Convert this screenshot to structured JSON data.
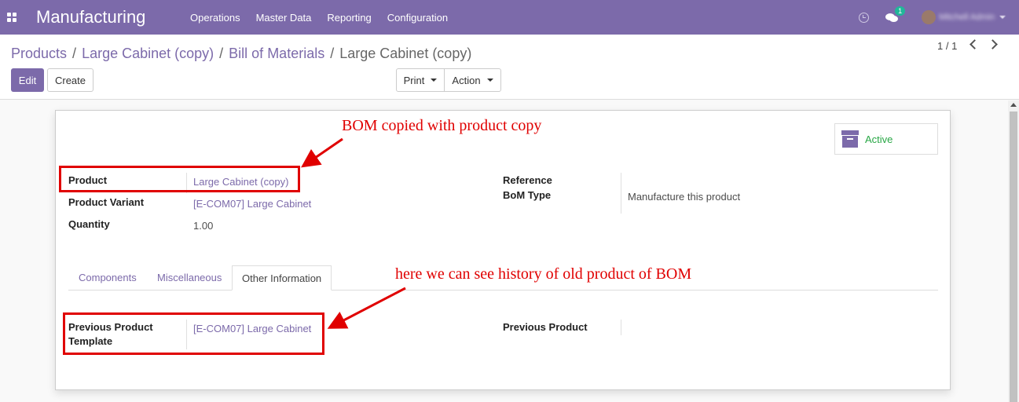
{
  "navbar": {
    "app_name": "Manufacturing",
    "menu": [
      "Operations",
      "Master Data",
      "Reporting",
      "Configuration"
    ],
    "chat_badge": "1",
    "user_name": "Mitchell Admin"
  },
  "breadcrumb": {
    "items": [
      "Products",
      "Large Cabinet (copy)",
      "Bill of Materials"
    ],
    "current": "Large Cabinet (copy)"
  },
  "buttons": {
    "edit": "Edit",
    "create": "Create",
    "print": "Print",
    "action": "Action"
  },
  "pager": {
    "value": "1 / 1"
  },
  "status": {
    "active_label": "Active"
  },
  "form": {
    "product_label": "Product",
    "product_value": "Large Cabinet (copy)",
    "variant_label": "Product Variant",
    "variant_value": "[E-COM07] Large Cabinet",
    "quantity_label": "Quantity",
    "quantity_value": "1.00",
    "reference_label": "Reference",
    "bom_type_label": "BoM Type",
    "bom_type_value": "Manufacture this product"
  },
  "tabs": {
    "components": "Components",
    "misc": "Miscellaneous",
    "other": "Other Information"
  },
  "other_info": {
    "prev_template_label_line1": "Previous Product",
    "prev_template_label_line2": "Template",
    "prev_template_value": "[E-COM07] Large Cabinet",
    "prev_product_label": "Previous Product"
  },
  "annotations": {
    "top": "BOM  copied with product copy",
    "bottom": "here we can see history of old product of BOM",
    "color": "#e00000"
  },
  "colors": {
    "brand": "#7c6aaa",
    "active_green": "#28a745"
  }
}
